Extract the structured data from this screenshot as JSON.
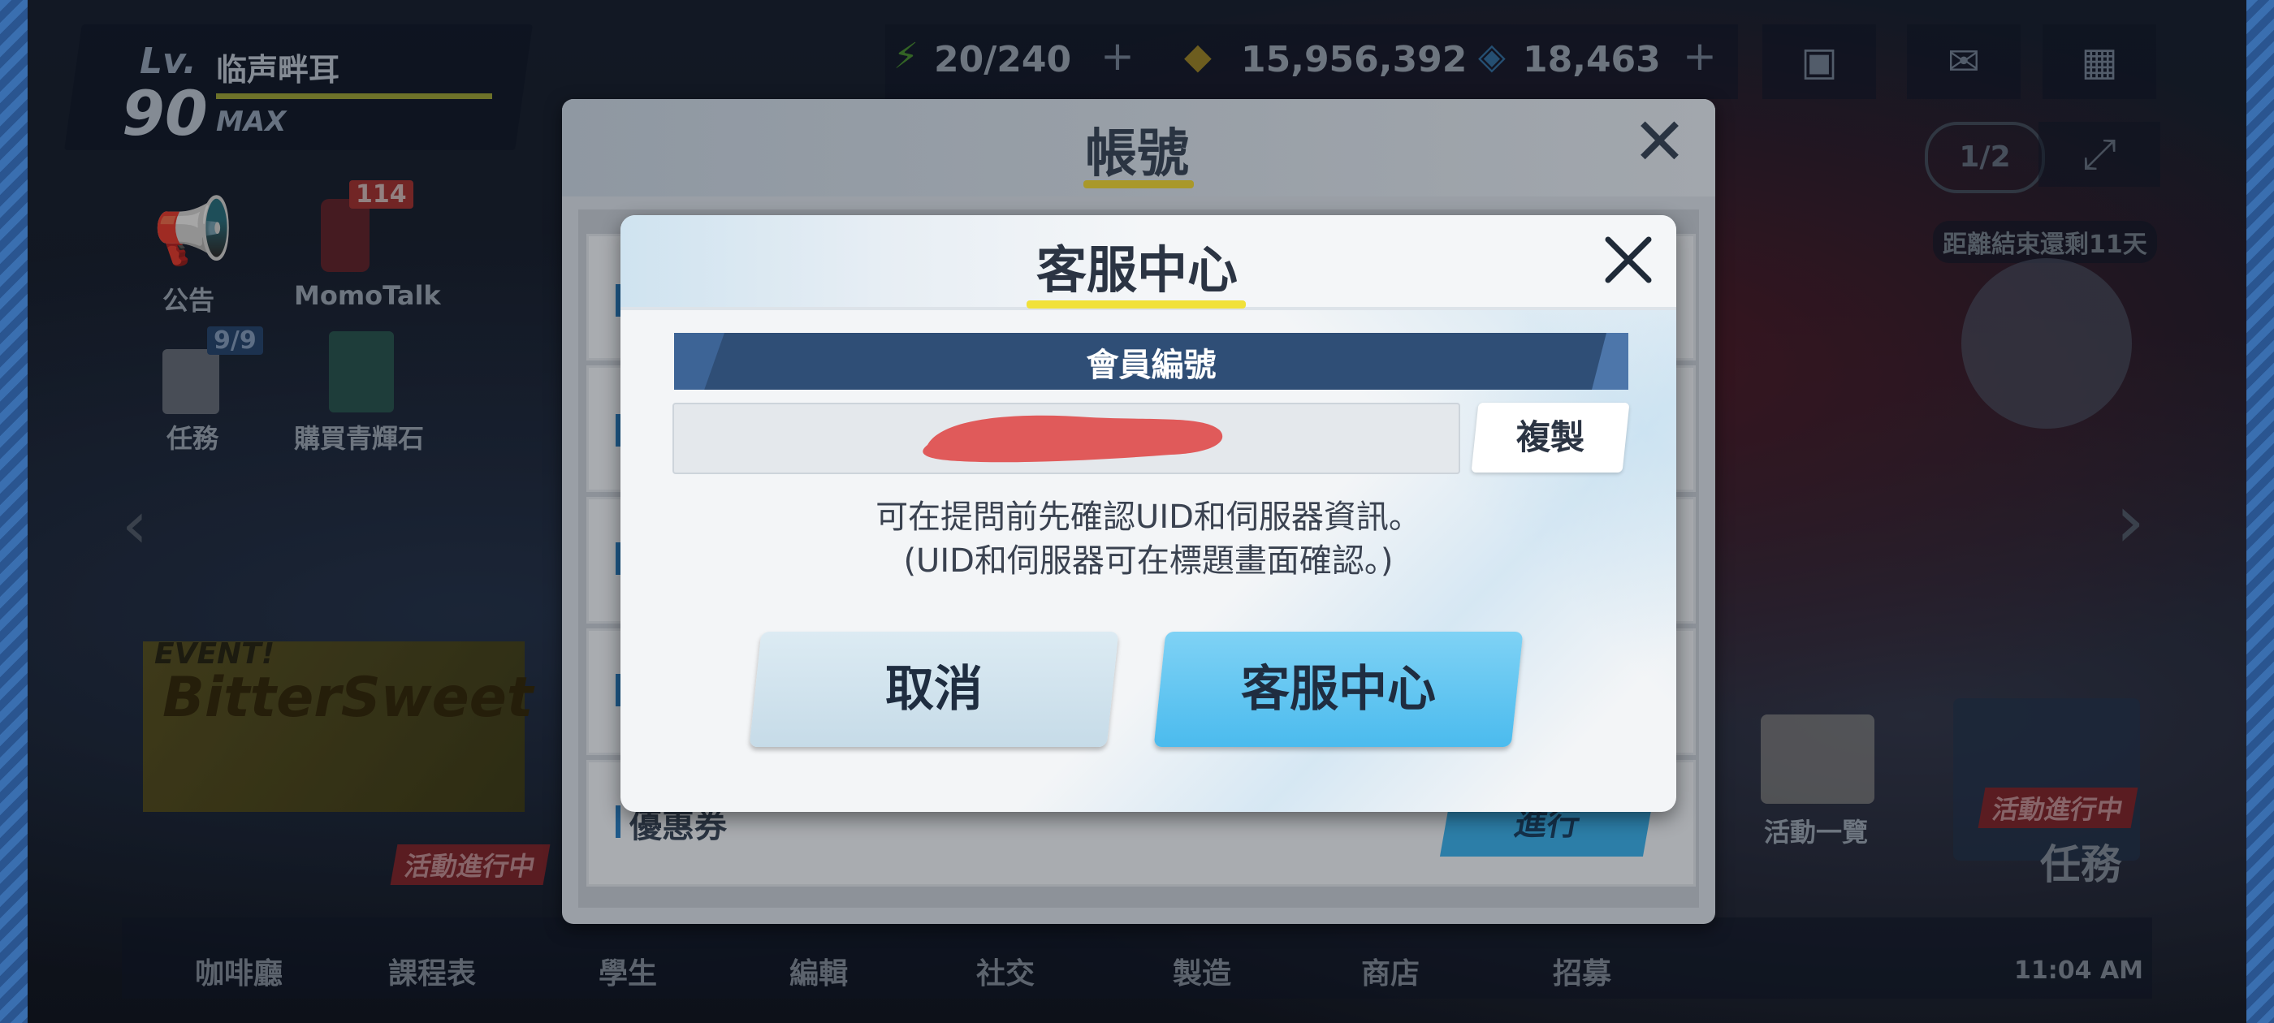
{
  "player": {
    "lv_label": "Lv.",
    "level": "90",
    "name": "临声畔耳",
    "max_label": "MAX"
  },
  "resources": {
    "ap": "20/240",
    "credits": "15,956,392",
    "pyroxene": "18,463"
  },
  "top_right": {
    "page_indicator": "1/2",
    "event_remaining": "距離結束還剩11天"
  },
  "left_menu": {
    "notice_label": "公告",
    "momotalk_label": "MomoTalk",
    "momotalk_badge": "114",
    "tasks_label": "任務",
    "tasks_badge": "9/9",
    "shop_label": "購買青輝石"
  },
  "event_banner": {
    "tag": "EVENT!",
    "title": "BitterSweet"
  },
  "right_widgets": {
    "events_list_label": "活動一覽",
    "in_progress": "活動進行中",
    "task_label": "任務"
  },
  "bottom_nav": {
    "items": [
      "咖啡廳",
      "課程表",
      "學生",
      "編輯",
      "社交",
      "製造",
      "商店",
      "招募"
    ],
    "in_progress": "活動進行中",
    "time": "11:04 AM"
  },
  "account_dialog": {
    "title": "帳號",
    "coupon_label": "優惠券",
    "go_label": "進行"
  },
  "support_dialog": {
    "title": "客服中心",
    "section_label": "會員編號",
    "copy_label": "複製",
    "info_line1": "可在提問前先確認UID和伺服器資訊。",
    "info_line2": "(UID和伺服器可在標題畫面確認。)",
    "cancel_label": "取消",
    "confirm_label": "客服中心"
  },
  "colors": {
    "accent_yellow": "#f1e13a",
    "band_blue": "#2f4e76",
    "confirm_blue": "#4bbbee",
    "redaction_red": "#e05a5a"
  }
}
